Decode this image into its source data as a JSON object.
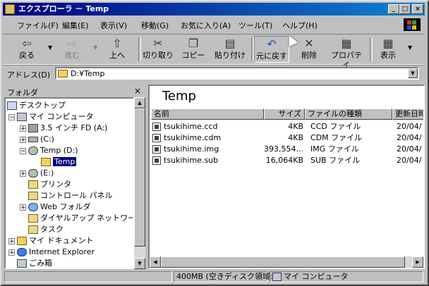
{
  "window": {
    "title": "エクスプローラ － Temp",
    "controls": [
      "_",
      "□",
      "×"
    ]
  },
  "menu": [
    "ファイル(F)",
    "編集(E)",
    "表示(V)",
    "移動(G)",
    "お気に入り(A)",
    "ツール(T)",
    "ヘルプ(H)"
  ],
  "toolbar": {
    "back": "戻る",
    "forward": "進む",
    "up": "上へ",
    "cut": "切り取り",
    "copy": "コピー",
    "paste": "貼り付け",
    "undo": "元に戻す",
    "delete": "削除",
    "properties": "プロパティ",
    "view": "表示"
  },
  "address": {
    "label": "アドレス(D)",
    "value": "D:¥Temp"
  },
  "folders": {
    "title": "フォルダ",
    "close": "×",
    "tree": [
      {
        "label": "デスクトップ"
      },
      {
        "label": "マイ コンピュータ"
      },
      {
        "label": "3.5 インチ FD (A:)"
      },
      {
        "label": "(C:)"
      },
      {
        "label": "Temp (D:)"
      },
      {
        "label": "Temp",
        "selected": true
      },
      {
        "label": "(E:)"
      },
      {
        "label": "プリンタ"
      },
      {
        "label": "コントロール パネル"
      },
      {
        "label": "Web フォルダ"
      },
      {
        "label": "ダイヤルアップ ネットワーク"
      },
      {
        "label": "タスク"
      },
      {
        "label": "マイ ドキュメント"
      },
      {
        "label": "Internet Explorer"
      },
      {
        "label": "ごみ箱"
      }
    ]
  },
  "content": {
    "title": "Temp",
    "columns": [
      "名前",
      "サイズ",
      "ファイルの種類",
      "更新日時"
    ],
    "files": [
      {
        "name": "tsukihime.ccd",
        "size": "4KB",
        "type": "CCD ファイル",
        "date": "20/04/"
      },
      {
        "name": "tsukihime.cdm",
        "size": "4KB",
        "type": "CDM ファイル",
        "date": "20/04/"
      },
      {
        "name": "tsukihime.img",
        "size": "393,554...",
        "type": "IMG ファイル",
        "date": "20/04/"
      },
      {
        "name": "tsukihime.sub",
        "size": "16,064KB",
        "type": "SUB ファイル",
        "date": "20/04/"
      }
    ]
  },
  "status": {
    "disk": "400MB (空きディスク領域:",
    "location": "マイ コンピュータ"
  }
}
